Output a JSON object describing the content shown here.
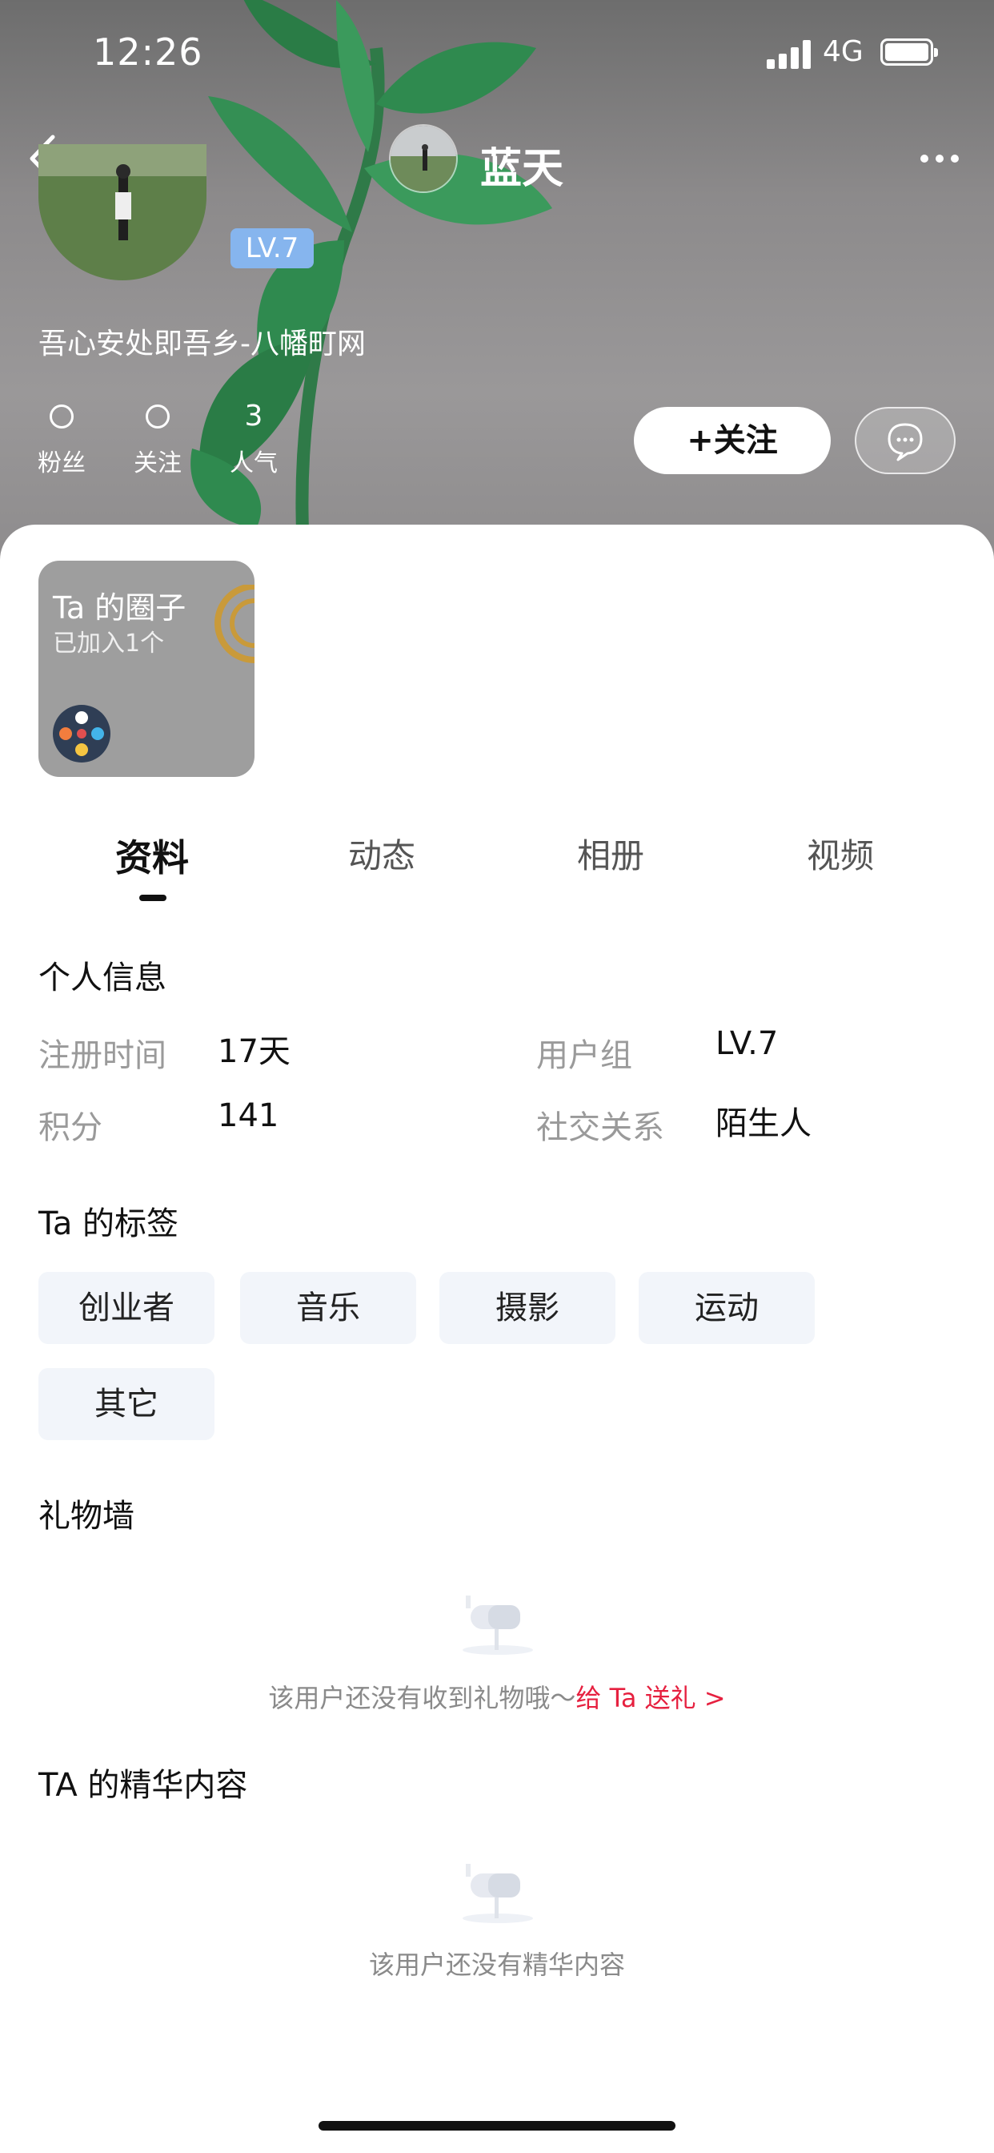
{
  "status_bar": {
    "time": "12:26",
    "network": "4G"
  },
  "nav": {
    "title": "蓝天"
  },
  "profile": {
    "level_badge": "LV.7",
    "signature": "吾心安处即吾乡-八幡町网",
    "stats": [
      {
        "value": "",
        "label": "粉丝"
      },
      {
        "value": "",
        "label": "关注"
      },
      {
        "value": "3",
        "label": "人气"
      }
    ],
    "follow_label": "+关注"
  },
  "circle": {
    "title": "Ta 的圈子",
    "subtitle": "已加入1个"
  },
  "tabs": [
    {
      "label": "资料"
    },
    {
      "label": "动态"
    },
    {
      "label": "相册"
    },
    {
      "label": "视频"
    }
  ],
  "personal_info": {
    "title": "个人信息",
    "fields": [
      {
        "label": "注册时间",
        "value": "17天"
      },
      {
        "label": "用户组",
        "value": "LV.7"
      },
      {
        "label": "积分",
        "value": "141"
      },
      {
        "label": "社交关系",
        "value": "陌生人"
      }
    ]
  },
  "tags_section": {
    "title": "Ta 的标签",
    "tags": [
      "创业者",
      "音乐",
      "摄影",
      "运动",
      "其它"
    ]
  },
  "gift_wall": {
    "title": "礼物墙",
    "empty_text": "该用户还没有收到礼物哦～",
    "link_text": "给 Ta 送礼",
    "link_chevron": ">"
  },
  "featured": {
    "title": "TA 的精华内容",
    "empty_text": "该用户还没有精华内容"
  },
  "colors": {
    "accent_red": "#e6203f",
    "level_badge": "#86b5ee",
    "tag_bg": "#f2f5fa"
  }
}
